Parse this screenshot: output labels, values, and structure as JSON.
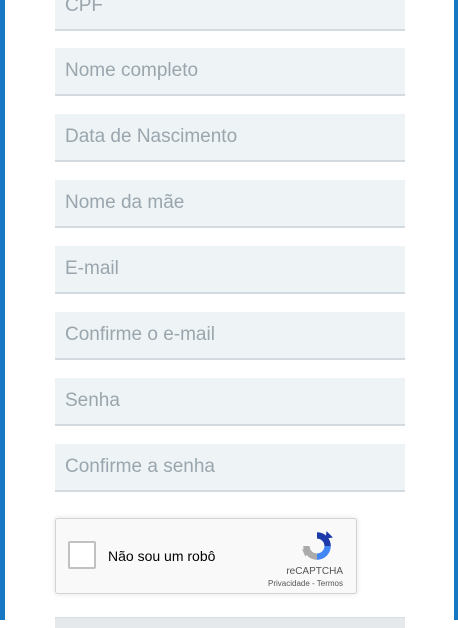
{
  "form": {
    "fields": [
      {
        "placeholder": "CPF"
      },
      {
        "placeholder": "Nome completo"
      },
      {
        "placeholder": "Data de Nascimento"
      },
      {
        "placeholder": "Nome da mãe"
      },
      {
        "placeholder": "E-mail"
      },
      {
        "placeholder": "Confirme o e-mail"
      },
      {
        "placeholder": "Senha"
      },
      {
        "placeholder": "Confirme a senha"
      }
    ]
  },
  "recaptcha": {
    "label": "Não sou um robô",
    "brand": "reCAPTCHA",
    "privacy": "Privacidade",
    "separator": " - ",
    "terms": "Termos",
    "logo_icon": "recaptcha-logo-icon"
  },
  "colors": {
    "frame_accent": "#1678c2",
    "field_background": "#eef3f5",
    "field_border": "#d3dbe0",
    "placeholder": "#9aa6ae"
  }
}
